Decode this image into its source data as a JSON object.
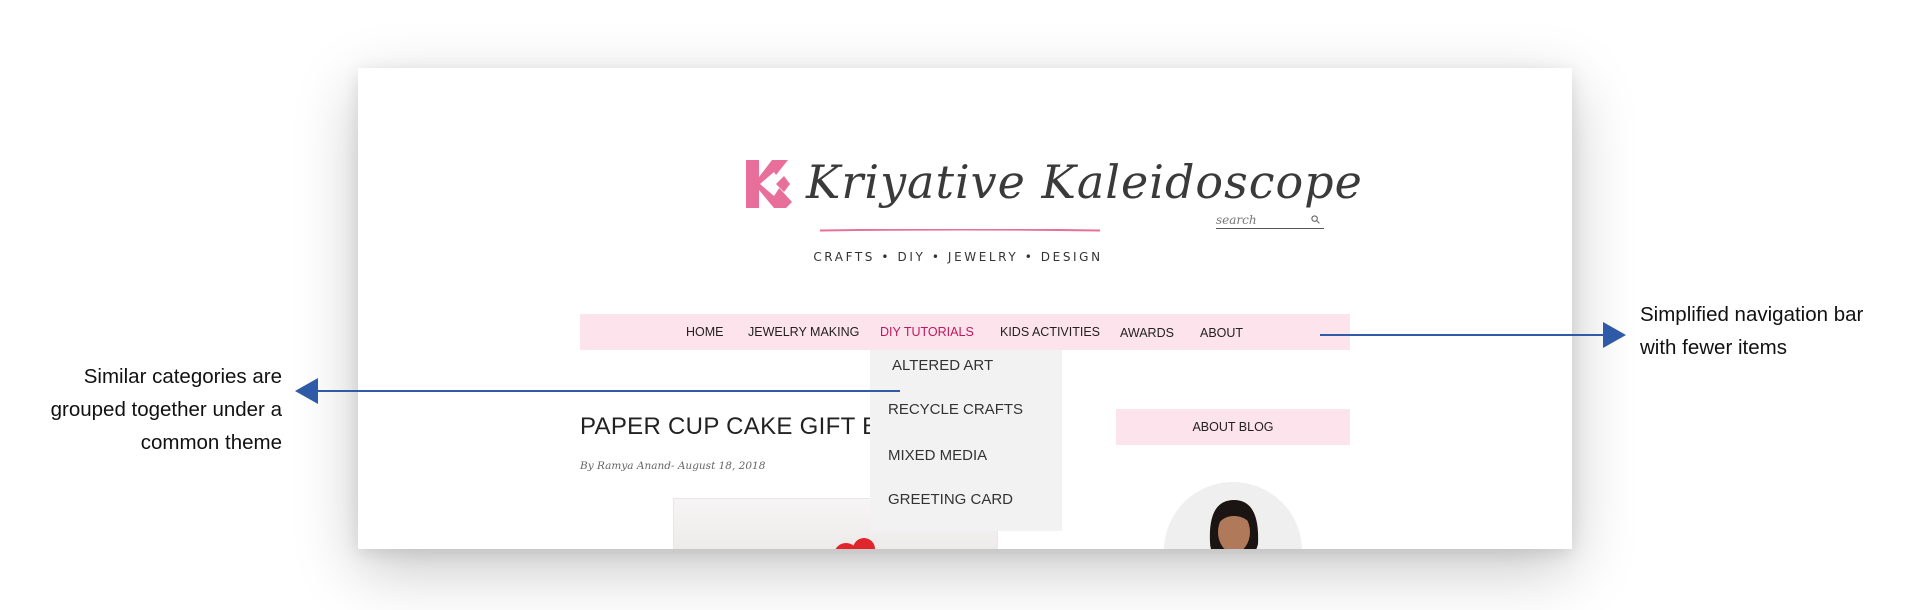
{
  "site": {
    "name": "Kriyative Kaleidoscope",
    "tagline": "CRAFTS • DIY • JEWELRY • DESIGN",
    "brand_color": "#e86f9a"
  },
  "search": {
    "placeholder": "search",
    "icon": "search-icon"
  },
  "nav": {
    "items": [
      {
        "label": "HOME"
      },
      {
        "label": "JEWELRY MAKING"
      },
      {
        "label": "DIY TUTORIALS",
        "active": true
      },
      {
        "label": "KIDS ACTIVITIES"
      },
      {
        "label": "AWARDS"
      },
      {
        "label": "ABOUT"
      }
    ],
    "background": "#fde3ec",
    "active_color": "#c2185b"
  },
  "dropdown": {
    "items": [
      {
        "label": "ALTERED ART"
      },
      {
        "label": "RECYCLE CRAFTS"
      },
      {
        "label": "MIXED MEDIA"
      },
      {
        "label": "GREETING CARD"
      }
    ]
  },
  "post": {
    "title": "PAPER CUP CAKE GIFT B",
    "meta": "By Ramya Anand- August 18, 2018"
  },
  "sidebar": {
    "heading": "ABOUT BLOG"
  },
  "annotations": {
    "left": [
      "Similar categories are",
      "grouped together under a",
      "common theme"
    ],
    "right": [
      "Simplified navigation bar",
      "with fewer items"
    ],
    "arrow_color": "#2f5aa8"
  }
}
